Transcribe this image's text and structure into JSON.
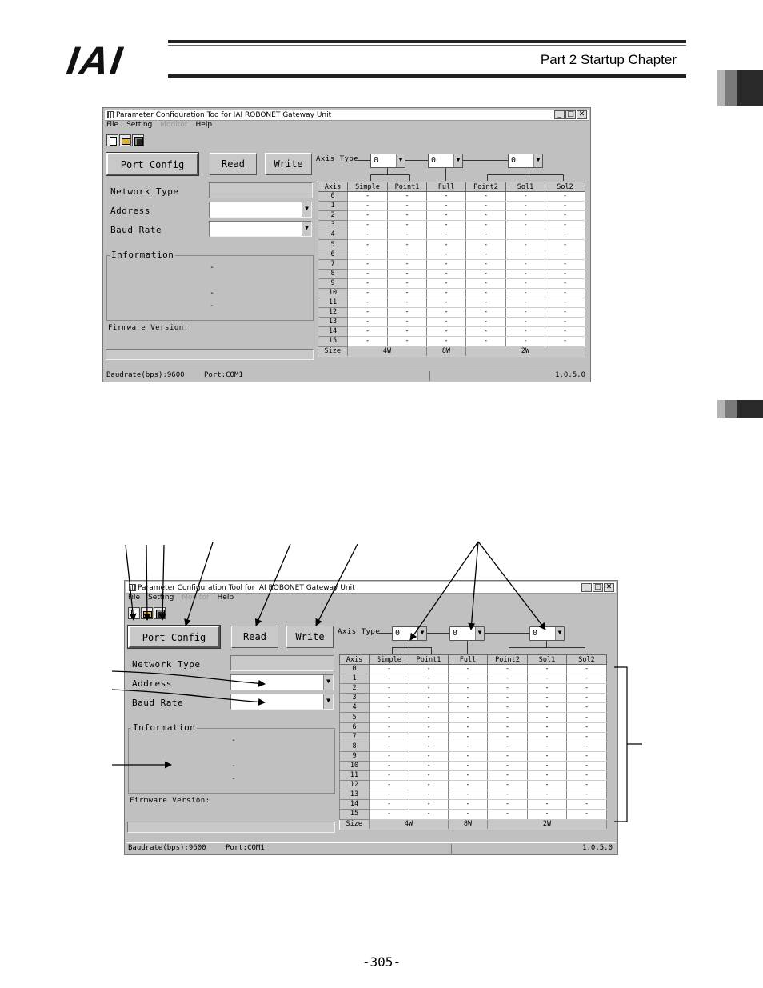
{
  "header": {
    "logo": "IAI",
    "chapter": "Part 2  Startup Chapter",
    "tab_colors": [
      "#b4b4b4",
      "#7a7a7a",
      "#2a2a2a"
    ]
  },
  "window": {
    "title_top": "Parameter Configuration Too for IAI ROBONET Gateway Unit",
    "title_bottom": "Parameter Configuration Tool for IAI ROBONET Gateway Unit",
    "controls": [
      "_",
      "□",
      "✕"
    ],
    "menu": [
      "File",
      "Setting",
      "Monitor",
      "Help"
    ],
    "toolbar_icons": [
      "new-icon",
      "open-icon",
      "save-icon"
    ],
    "buttons": {
      "port_config": "Port Config",
      "read": "Read",
      "write": "Write"
    },
    "axis_type_label": "Axis Type",
    "axis_type_values": [
      "0",
      "0",
      "0"
    ],
    "labels": {
      "network_type": "Network Type",
      "address": "Address",
      "baud_rate": "Baud Rate",
      "information": "Information",
      "firmware": "Firmware Version:"
    },
    "info_dashes": [
      "-",
      "-",
      "-"
    ],
    "table": {
      "columns": [
        "Axis",
        "Simple",
        "Point1",
        "Full",
        "Point2",
        "Sol1",
        "Sol2"
      ],
      "axes": [
        "0",
        "1",
        "2",
        "3",
        "4",
        "5",
        "6",
        "7",
        "8",
        "9",
        "10",
        "11",
        "12",
        "13",
        "14",
        "15"
      ],
      "cell": "-",
      "size_label": "Size",
      "sizes": [
        "4W",
        "8W",
        "2W"
      ]
    },
    "status": {
      "baud": "Baudrate(bps):9600",
      "port": "Port:COM1",
      "version": "1.0.5.0"
    }
  },
  "footer": {
    "page_number": "-305-"
  }
}
